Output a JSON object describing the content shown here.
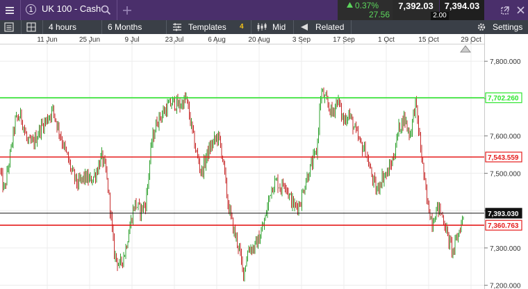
{
  "toolbar": {
    "menu_icon": "hamburger-menu-icon",
    "market_number": "1",
    "symbol": "UK 100 - Cash",
    "search_icon": "search-icon",
    "add_icon": "plus-icon",
    "change_pct": "0.37%",
    "change_pts": "27.56",
    "bid": "7,392.03",
    "offer": "7,394.03",
    "spread": "2.00"
  },
  "chart_toolbar": {
    "interval": "4 hours",
    "range": "6 Months",
    "templates_label": "Templates",
    "indicator_count": "4",
    "price_mode": "Mid",
    "related_label": "Related",
    "settings_label": "Settings"
  },
  "colors": {
    "up": "#2ea02e",
    "down": "#c62828",
    "resistance_green": "#2ee52e",
    "level_red": "#e51c1c",
    "current": "#111111",
    "header": "#4a2f6b"
  },
  "chart_data": {
    "type": "candlestick",
    "x_tick_labels": [
      "11 Jun",
      "25 Jun",
      "9 Jul",
      "23 Jul",
      "6 Aug",
      "20 Aug",
      "3 Sep",
      "17 Sep",
      "1 Oct",
      "15 Oct",
      "29 Oct"
    ],
    "y_tick_labels": [
      "7,800.000",
      "7,700.000",
      "7,600.000",
      "7,500.000",
      "7,400.000",
      "7,300.000",
      "7,200.000"
    ],
    "ylim": [
      7190,
      7845
    ],
    "grid": true,
    "horizontal_levels": [
      {
        "value": 7702.26,
        "label": "7,702.260",
        "color": "#2ee52e"
      },
      {
        "value": 7543.559,
        "label": "7,543.559",
        "color": "#e51c1c"
      },
      {
        "value": 7393.03,
        "label": "7,393.030",
        "color": "#111111"
      },
      {
        "value": 7360.763,
        "label": "7,360.763",
        "color": "#e51c1c"
      }
    ],
    "price_path": [
      [
        0,
        7510
      ],
      [
        6,
        7450
      ],
      [
        14,
        7540
      ],
      [
        22,
        7640
      ],
      [
        30,
        7655
      ],
      [
        40,
        7580
      ],
      [
        48,
        7580
      ],
      [
        58,
        7620
      ],
      [
        66,
        7640
      ],
      [
        76,
        7670
      ],
      [
        84,
        7620
      ],
      [
        94,
        7560
      ],
      [
        104,
        7500
      ],
      [
        112,
        7470
      ],
      [
        122,
        7490
      ],
      [
        130,
        7480
      ],
      [
        138,
        7500
      ],
      [
        146,
        7545
      ],
      [
        152,
        7510
      ],
      [
        158,
        7420
      ],
      [
        164,
        7290
      ],
      [
        172,
        7250
      ],
      [
        180,
        7290
      ],
      [
        186,
        7350
      ],
      [
        194,
        7420
      ],
      [
        202,
        7400
      ],
      [
        210,
        7420
      ],
      [
        218,
        7580
      ],
      [
        226,
        7640
      ],
      [
        234,
        7660
      ],
      [
        242,
        7680
      ],
      [
        250,
        7690
      ],
      [
        258,
        7680
      ],
      [
        268,
        7700
      ],
      [
        274,
        7640
      ],
      [
        282,
        7560
      ],
      [
        290,
        7500
      ],
      [
        298,
        7550
      ],
      [
        306,
        7580
      ],
      [
        314,
        7600
      ],
      [
        320,
        7550
      ],
      [
        328,
        7420
      ],
      [
        336,
        7350
      ],
      [
        344,
        7300
      ],
      [
        350,
        7230
      ],
      [
        358,
        7300
      ],
      [
        366,
        7300
      ],
      [
        374,
        7330
      ],
      [
        382,
        7380
      ],
      [
        390,
        7460
      ],
      [
        398,
        7480
      ],
      [
        404,
        7460
      ],
      [
        410,
        7480
      ],
      [
        416,
        7440
      ],
      [
        424,
        7410
      ],
      [
        432,
        7420
      ],
      [
        440,
        7480
      ],
      [
        448,
        7520
      ],
      [
        456,
        7560
      ],
      [
        462,
        7720
      ],
      [
        470,
        7690
      ],
      [
        478,
        7660
      ],
      [
        486,
        7700
      ],
      [
        494,
        7640
      ],
      [
        502,
        7660
      ],
      [
        510,
        7620
      ],
      [
        518,
        7580
      ],
      [
        526,
        7560
      ],
      [
        534,
        7500
      ],
      [
        542,
        7450
      ],
      [
        550,
        7490
      ],
      [
        558,
        7500
      ],
      [
        566,
        7540
      ],
      [
        574,
        7620
      ],
      [
        582,
        7650
      ],
      [
        590,
        7600
      ],
      [
        598,
        7690
      ],
      [
        606,
        7560
      ],
      [
        614,
        7430
      ],
      [
        622,
        7370
      ],
      [
        630,
        7410
      ],
      [
        638,
        7380
      ],
      [
        646,
        7320
      ],
      [
        652,
        7290
      ],
      [
        660,
        7340
      ],
      [
        668,
        7393
      ]
    ]
  }
}
